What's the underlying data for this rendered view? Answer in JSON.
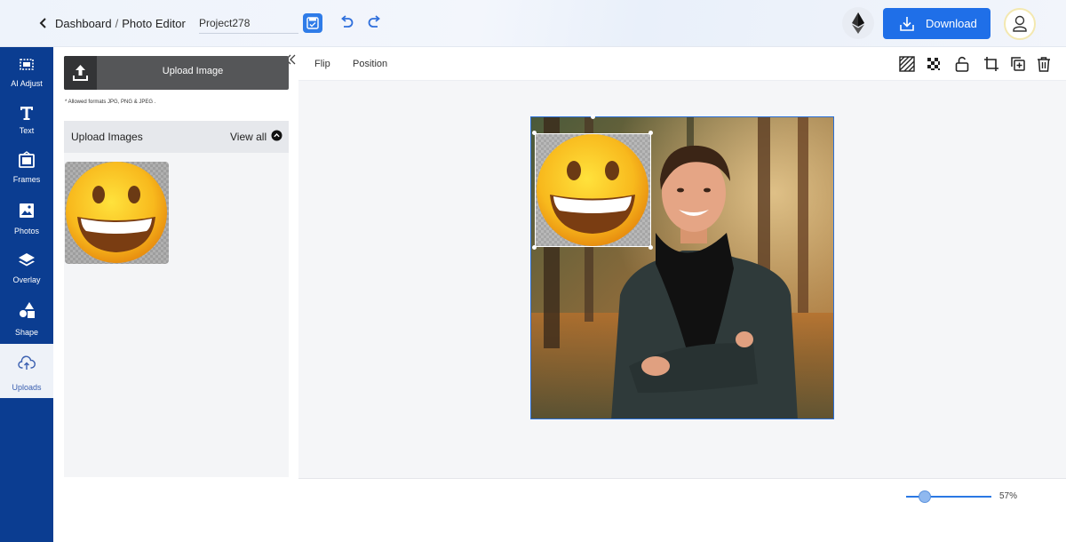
{
  "header": {
    "breadcrumb_root": "Dashboard",
    "breadcrumb_separator": "/",
    "breadcrumb_current": "Photo Editor",
    "project_name": "Project278",
    "download_label": "Download",
    "accent_color": "#1f6fe8"
  },
  "nav": {
    "items": [
      {
        "label": "AI Adjust",
        "icon": "ai-adjust-icon"
      },
      {
        "label": "Text",
        "icon": "text-icon"
      },
      {
        "label": "Frames",
        "icon": "frames-icon"
      },
      {
        "label": "Photos",
        "icon": "photos-icon"
      },
      {
        "label": "Overlay",
        "icon": "layers-icon"
      },
      {
        "label": "Shape",
        "icon": "shape-icon"
      },
      {
        "label": "Uploads",
        "icon": "cloud-upload-icon",
        "active": true
      }
    ],
    "background_color": "#0b3d91"
  },
  "panel": {
    "upload_button": "Upload Image",
    "formats_note": "* Allowed formats JPG, PNG & JPEG .",
    "section_title": "Upload Images",
    "view_all": "View all",
    "thumbnails": [
      {
        "icon": "grinning-emoji-icon"
      }
    ]
  },
  "toolbar": {
    "flip": "Flip",
    "position": "Position",
    "icons": [
      "transparency-icon",
      "checkerboard-icon",
      "unlock-icon",
      "crop-icon",
      "duplicate-icon",
      "trash-icon"
    ]
  },
  "zoom": {
    "value_label": "57%",
    "level": 0.57
  }
}
